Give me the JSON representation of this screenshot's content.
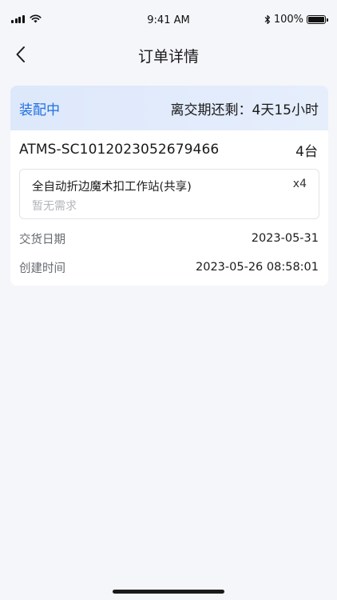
{
  "status_bar": {
    "time": "9:41 AM",
    "battery": "100%",
    "icons": [
      "signal-icon",
      "wifi-icon",
      "bluetooth-icon",
      "battery-icon"
    ]
  },
  "nav": {
    "title": "订单详情",
    "back_icon": "chevron-left-icon"
  },
  "order": {
    "status": "装配中",
    "countdown": "离交期还剩：4天15小时",
    "number": "ATMS-SC1012023052679466",
    "quantity": "4台",
    "product": {
      "name": "全自动折边魔术扣工作站(共享)",
      "count": "x4",
      "note": "暂无需求"
    },
    "details": [
      {
        "label": "交货日期",
        "value": "2023-05-31"
      },
      {
        "label": "创建时间",
        "value": "2023-05-26 08:58:01"
      }
    ]
  },
  "colors": {
    "accent": "#1f6fe0",
    "page_bg": "#f5f6fa",
    "header_bg": "#dde8fb",
    "muted_text": "#b2b5ba"
  }
}
